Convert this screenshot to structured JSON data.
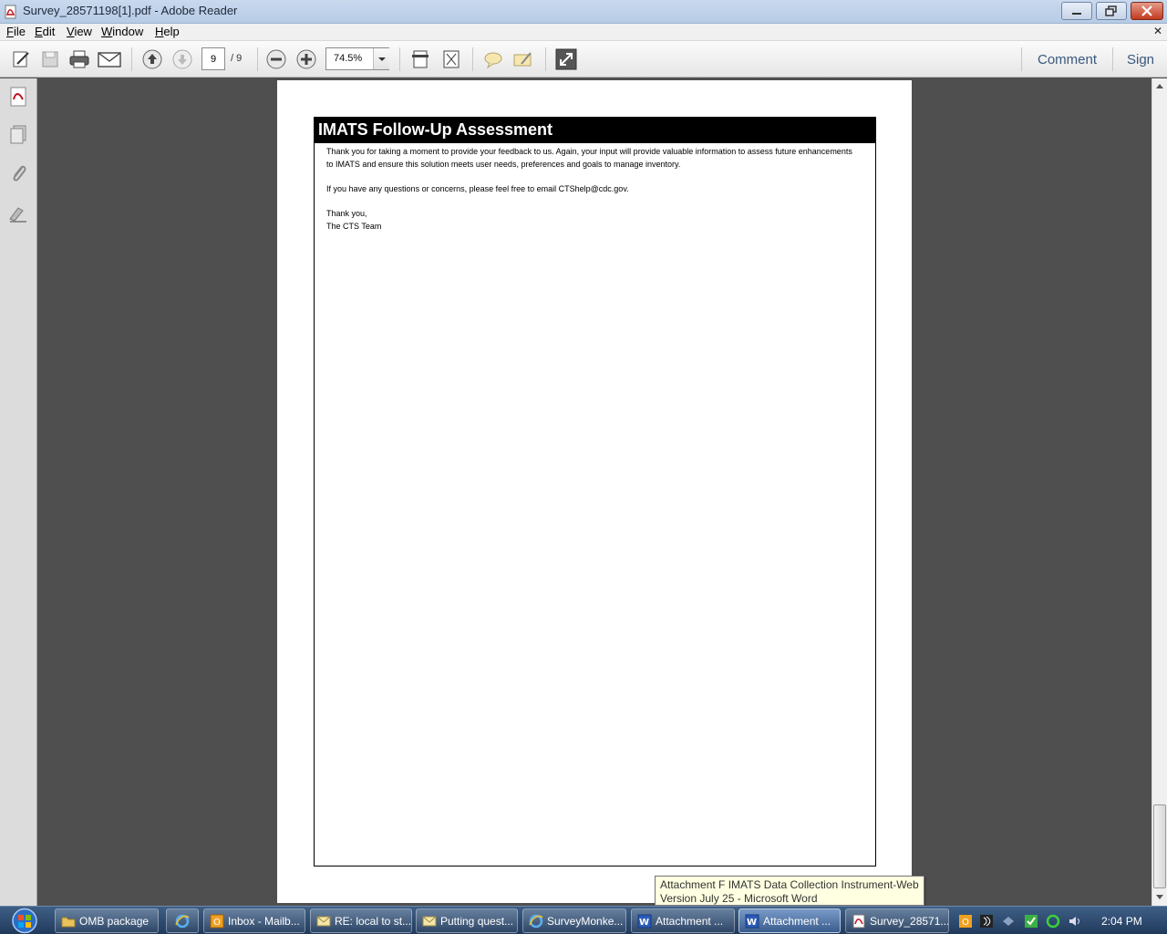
{
  "window": {
    "title": "Survey_28571198[1].pdf - Adobe Reader"
  },
  "menu": {
    "file": "File",
    "edit": "Edit",
    "view": "View",
    "window": "Window",
    "help": "Help",
    "close_glyph": "✕"
  },
  "toolbar": {
    "current_page": "9",
    "page_total": "/  9",
    "zoom": "74.5%",
    "comment": "Comment",
    "sign": "Sign"
  },
  "document": {
    "title": "IMATS Follow-Up Assessment",
    "para1_line1": "Thank you for taking a moment to provide your feedback to us. Again, your input will provide valuable information to assess future enhancements",
    "para1_line2": "to IMATS and ensure this solution meets user needs, preferences and goals to manage inventory.",
    "para2": "If you have any questions or concerns, please feel free to email CTShelp@cdc.gov.",
    "closing": "Thank you,",
    "signature": "The CTS Team"
  },
  "tooltip": {
    "line1": "Attachment F IMATS Data Collection Instrument-Web",
    "line2": "Version July 25 - Microsoft Word"
  },
  "taskbar": {
    "items": [
      {
        "label": "OMB package",
        "icon": "folder-icon"
      },
      {
        "label": "",
        "icon": "internet-explorer-icon"
      },
      {
        "label": "Inbox - Mailb...",
        "icon": "outlook-icon"
      },
      {
        "label": "RE: local to st...",
        "icon": "envelope-icon"
      },
      {
        "label": "Putting quest...",
        "icon": "envelope-icon"
      },
      {
        "label": "SurveyMonke...",
        "icon": "internet-explorer-icon"
      },
      {
        "label": "Attachment ...",
        "icon": "word-icon"
      },
      {
        "label": "Attachment ...",
        "icon": "word-icon"
      },
      {
        "label": "Survey_28571...",
        "icon": "pdf-icon"
      }
    ],
    "clock": "2:04 PM"
  },
  "colors": {
    "title_band": "#000000",
    "doc_background": "#4f4f4f",
    "link_text": "#3a587d"
  }
}
